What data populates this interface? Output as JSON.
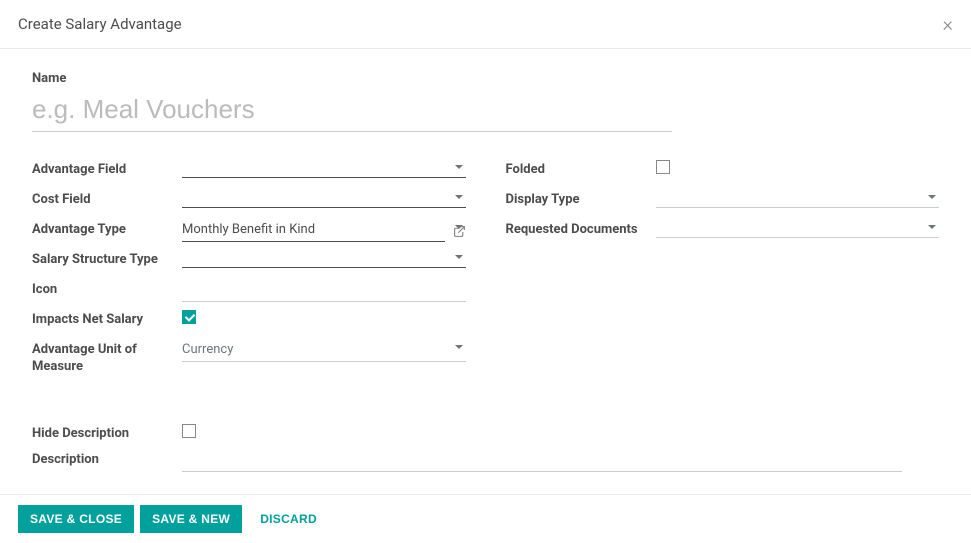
{
  "dialog": {
    "title": "Create Salary Advantage",
    "close": "×"
  },
  "name": {
    "label": "Name",
    "placeholder": "e.g. Meal Vouchers",
    "value": ""
  },
  "left": {
    "advantage_field": {
      "label": "Advantage Field",
      "value": ""
    },
    "cost_field": {
      "label": "Cost Field",
      "value": ""
    },
    "advantage_type": {
      "label": "Advantage Type",
      "value": "Monthly Benefit in Kind"
    },
    "salary_structure_type": {
      "label": "Salary Structure Type",
      "value": ""
    },
    "icon": {
      "label": "Icon",
      "value": ""
    },
    "impacts_net_salary": {
      "label": "Impacts Net Salary",
      "checked": true
    },
    "advantage_unit": {
      "label": "Advantage Unit of Measure",
      "value": "Currency"
    }
  },
  "right": {
    "folded": {
      "label": "Folded",
      "checked": false
    },
    "display_type": {
      "label": "Display Type",
      "value": ""
    },
    "requested_documents": {
      "label": "Requested Documents",
      "value": ""
    }
  },
  "bottom": {
    "hide_description": {
      "label": "Hide Description",
      "checked": false
    },
    "description": {
      "label": "Description",
      "value": ""
    }
  },
  "footer": {
    "save_close": "SAVE & CLOSE",
    "save_new": "SAVE & NEW",
    "discard": "DISCARD"
  }
}
